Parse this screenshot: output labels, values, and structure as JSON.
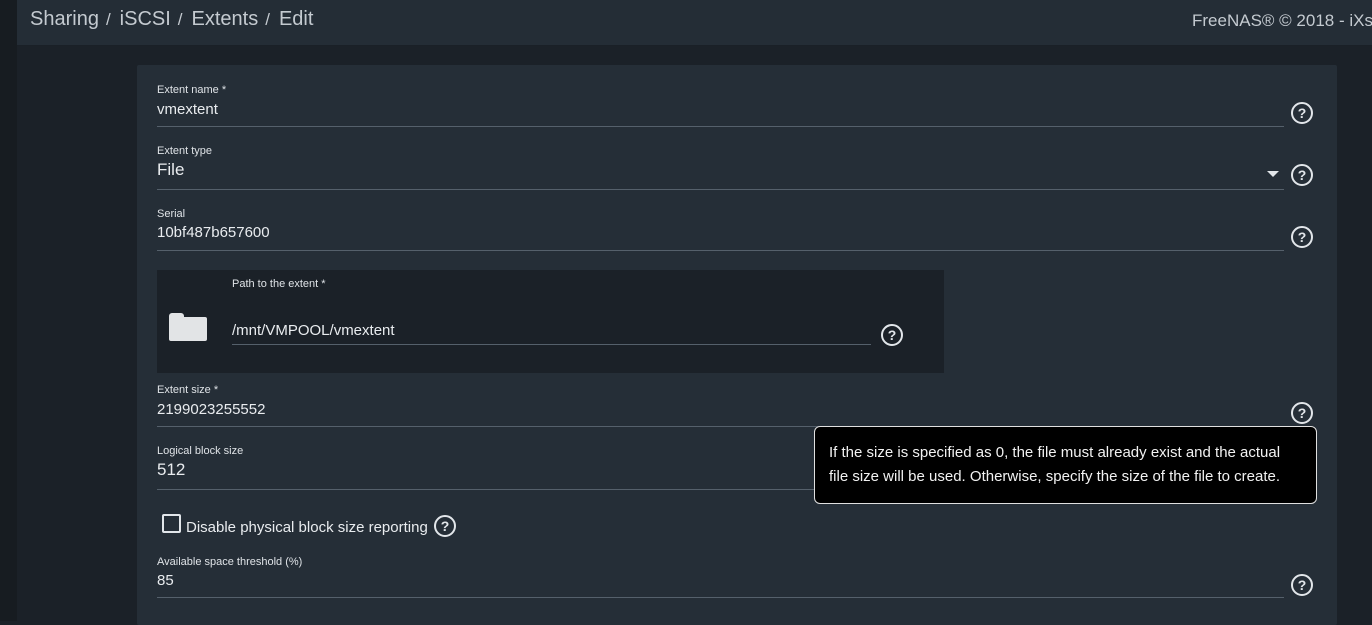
{
  "breadcrumb": {
    "items": [
      "Sharing",
      "iSCSI",
      "Extents",
      "Edit"
    ],
    "separator": "/"
  },
  "copyright": "FreeNAS® © 2018 - iXs",
  "form": {
    "extent_name": {
      "label": "Extent name *",
      "value": "vmextent"
    },
    "extent_type": {
      "label": "Extent type",
      "value": "File"
    },
    "serial": {
      "label": "Serial",
      "value": "10bf487b657600"
    },
    "path": {
      "label": "Path to the extent *",
      "value": "/mnt/VMPOOL/vmextent"
    },
    "extent_size": {
      "label": "Extent size *",
      "value": "2199023255552"
    },
    "logical_block_size": {
      "label": "Logical block size",
      "value": "512"
    },
    "disable_physical_block": {
      "label": "Disable physical block size reporting",
      "checked": false
    },
    "space_threshold": {
      "label": "Available space threshold (%)",
      "value": "85"
    }
  },
  "tooltip": {
    "text": "If the size is specified as 0, the file must already exist and the actual file size will be used. Otherwise, specify the size of the file to create."
  },
  "icons": {
    "help": "help-circle-icon",
    "folder": "folder-icon",
    "dropdown": "caret-down-icon"
  },
  "colors": {
    "background": "#1b2128",
    "card": "#252e37",
    "topbar": "#242d36",
    "tooltip_bg": "#000000"
  }
}
